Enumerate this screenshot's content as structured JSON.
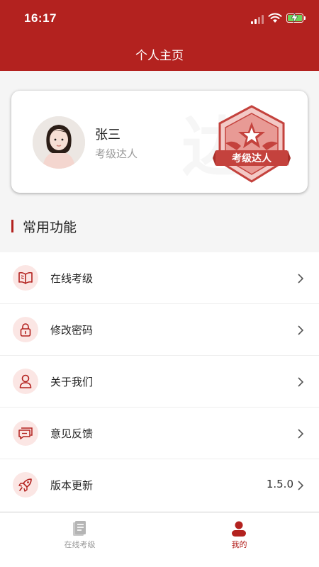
{
  "status_bar": {
    "time": "16:17"
  },
  "header": {
    "title": "个人主页"
  },
  "profile": {
    "name": "张三",
    "title": "考级达人",
    "badge_text": "考级达人",
    "watermark": "达"
  },
  "section": {
    "title": "常用功能"
  },
  "menu": [
    {
      "label": "在线考级",
      "icon": "book-icon",
      "value": ""
    },
    {
      "label": "修改密码",
      "icon": "lock-icon",
      "value": ""
    },
    {
      "label": "关于我们",
      "icon": "user-icon",
      "value": ""
    },
    {
      "label": "意见反馈",
      "icon": "feedback-icon",
      "value": ""
    },
    {
      "label": "版本更新",
      "icon": "rocket-icon",
      "value": "1.5.0"
    }
  ],
  "tabs": [
    {
      "label": "在线考级",
      "icon": "exam-icon",
      "active": false
    },
    {
      "label": "我的",
      "icon": "profile-icon",
      "active": true
    }
  ],
  "colors": {
    "brand": "#b3221f",
    "icon_bg": "#fbe6e4",
    "battery": "#6cd25a"
  }
}
